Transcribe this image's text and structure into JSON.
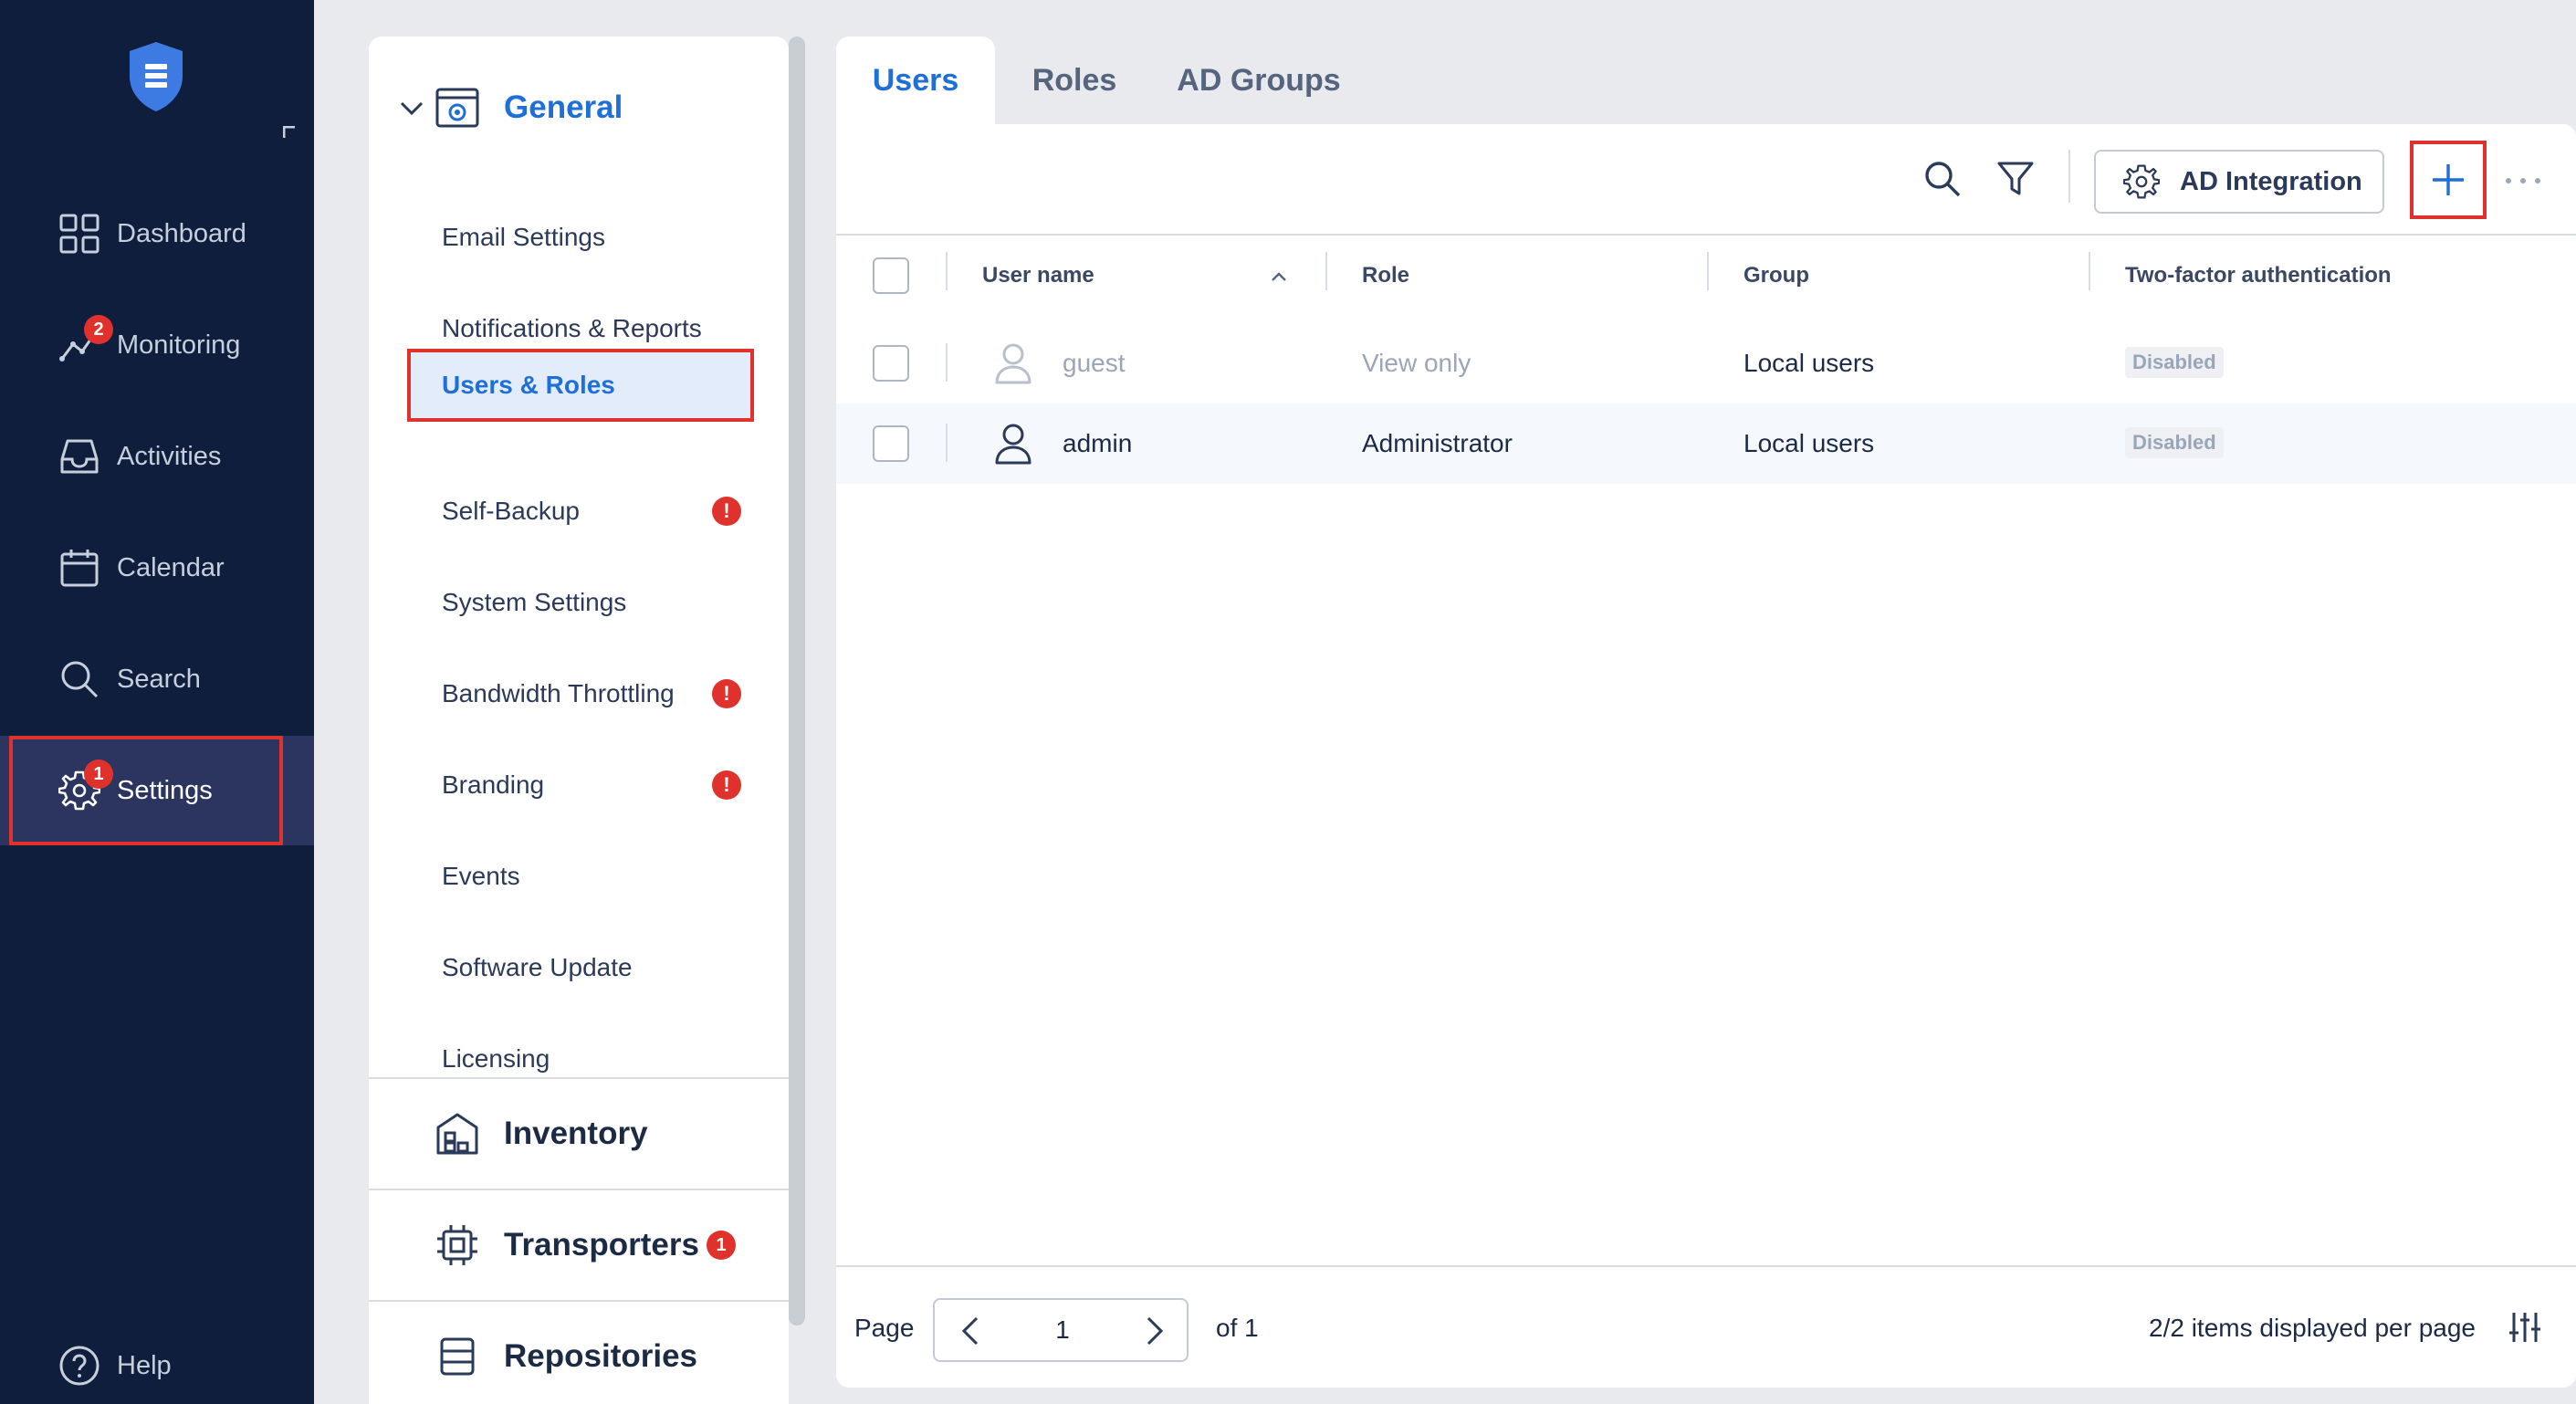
{
  "nav": {
    "items": [
      {
        "label": "Dashboard",
        "icon": "dashboard-icon"
      },
      {
        "label": "Monitoring",
        "icon": "monitoring-icon",
        "badge": "2"
      },
      {
        "label": "Activities",
        "icon": "inbox-icon"
      },
      {
        "label": "Calendar",
        "icon": "calendar-icon"
      },
      {
        "label": "Search",
        "icon": "search-icon"
      },
      {
        "label": "Settings",
        "icon": "gear-icon",
        "badge": "1"
      }
    ],
    "help_label": "Help"
  },
  "submenu": {
    "general": {
      "title": "General",
      "items": [
        {
          "label": "Email Settings"
        },
        {
          "label": "Notifications & Reports"
        },
        {
          "label": "Users & Roles",
          "selected": true
        },
        {
          "label": "Self-Backup",
          "warning": "!"
        },
        {
          "label": "System Settings"
        },
        {
          "label": "Bandwidth Throttling",
          "warning": "!"
        },
        {
          "label": "Branding",
          "warning": "!"
        },
        {
          "label": "Events"
        },
        {
          "label": "Software Update"
        },
        {
          "label": "Licensing"
        }
      ]
    },
    "inventory": {
      "title": "Inventory"
    },
    "transporters": {
      "title": "Transporters",
      "badge": "1"
    },
    "repositories": {
      "title": "Repositories"
    }
  },
  "tabs": [
    {
      "label": "Users",
      "active": true
    },
    {
      "label": "Roles"
    },
    {
      "label": "AD Groups"
    }
  ],
  "toolbar": {
    "ad_integration_label": "AD Integration"
  },
  "table": {
    "columns": {
      "user_name": "User name",
      "role": "Role",
      "group": "Group",
      "two_factor": "Two-factor authentication"
    },
    "rows": [
      {
        "user": "guest",
        "role": "View only",
        "group": "Local users",
        "two_factor": "Disabled"
      },
      {
        "user": "admin",
        "role": "Administrator",
        "group": "Local users",
        "two_factor": "Disabled"
      }
    ]
  },
  "pager": {
    "page_label": "Page",
    "current_page": "1",
    "of_label": "of 1",
    "per_page_label": "2/2 items displayed per page"
  },
  "colors": {
    "nav_bg": "#0f1e3d",
    "accent": "#1f6fd8",
    "highlight": "#e0322c"
  }
}
